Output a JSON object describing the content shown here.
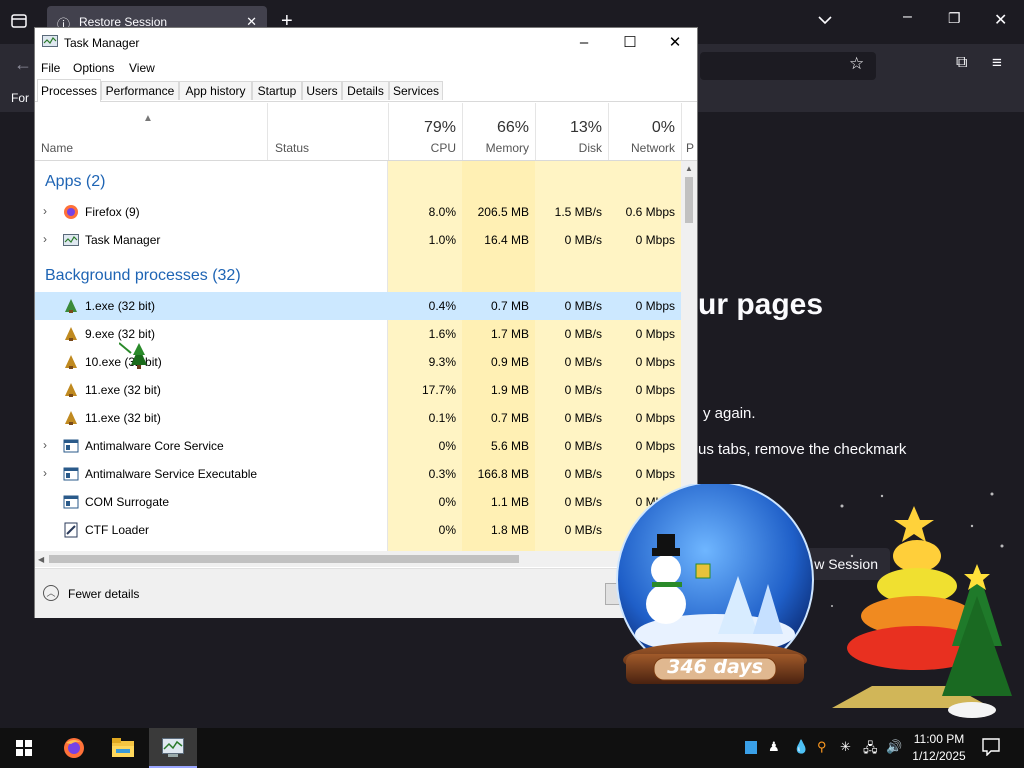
{
  "firefox": {
    "tab_title": "Restore Session",
    "bookmark_text": "For",
    "heading": "ur pages",
    "line1": "y again.",
    "line2": "us tabs, remove the checkmark",
    "button": "w Session"
  },
  "taskmanager": {
    "title": "Task Manager",
    "menu": [
      "File",
      "Options",
      "View"
    ],
    "tabs": [
      "Processes",
      "Performance",
      "App history",
      "Startup",
      "Users",
      "Details",
      "Services"
    ],
    "headers": {
      "name": "Name",
      "status": "Status",
      "cpu_pct": "79%",
      "cpu": "CPU",
      "mem_pct": "66%",
      "mem": "Memory",
      "disk_pct": "13%",
      "disk": "Disk",
      "net_pct": "0%",
      "net": "Network",
      "extra": "P"
    },
    "groups": {
      "apps": "Apps (2)",
      "background": "Background processes (32)"
    },
    "rows": [
      {
        "name": "Firefox (9)",
        "cpu": "8.0%",
        "mem": "206.5 MB",
        "disk": "1.5 MB/s",
        "net": "0.6 Mbps"
      },
      {
        "name": "Task Manager",
        "cpu": "1.0%",
        "mem": "16.4 MB",
        "disk": "0 MB/s",
        "net": "0 Mbps"
      },
      {
        "name": "1.exe (32 bit)",
        "cpu": "0.4%",
        "mem": "0.7 MB",
        "disk": "0 MB/s",
        "net": "0 Mbps"
      },
      {
        "name": "9.exe (32 bit)",
        "cpu": "1.6%",
        "mem": "1.7 MB",
        "disk": "0 MB/s",
        "net": "0 Mbps"
      },
      {
        "name": "10.exe (32 bit)",
        "cpu": "9.3%",
        "mem": "0.9 MB",
        "disk": "0 MB/s",
        "net": "0 Mbps"
      },
      {
        "name": "11.exe (32 bit)",
        "cpu": "17.7%",
        "mem": "1.9 MB",
        "disk": "0 MB/s",
        "net": "0 Mbps"
      },
      {
        "name": "11.exe (32 bit)",
        "cpu": "0.1%",
        "mem": "0.7 MB",
        "disk": "0 MB/s",
        "net": "0 Mbps"
      },
      {
        "name": "Antimalware Core Service",
        "cpu": "0%",
        "mem": "5.6 MB",
        "disk": "0 MB/s",
        "net": "0 Mbps"
      },
      {
        "name": "Antimalware Service Executable",
        "cpu": "0.3%",
        "mem": "166.8 MB",
        "disk": "0 MB/s",
        "net": "0 Mbps"
      },
      {
        "name": "COM Surrogate",
        "cpu": "0%",
        "mem": "1.1 MB",
        "disk": "0 MB/s",
        "net": "0 Mbps"
      },
      {
        "name": "CTF Loader",
        "cpu": "0%",
        "mem": "1.8 MB",
        "disk": "0 MB/s",
        "net": "0 Mbps"
      }
    ],
    "footer": "Fewer details"
  },
  "gadget": {
    "days": "346 days"
  },
  "taskbar": {
    "time": "11:00 PM",
    "date": "1/12/2025"
  }
}
